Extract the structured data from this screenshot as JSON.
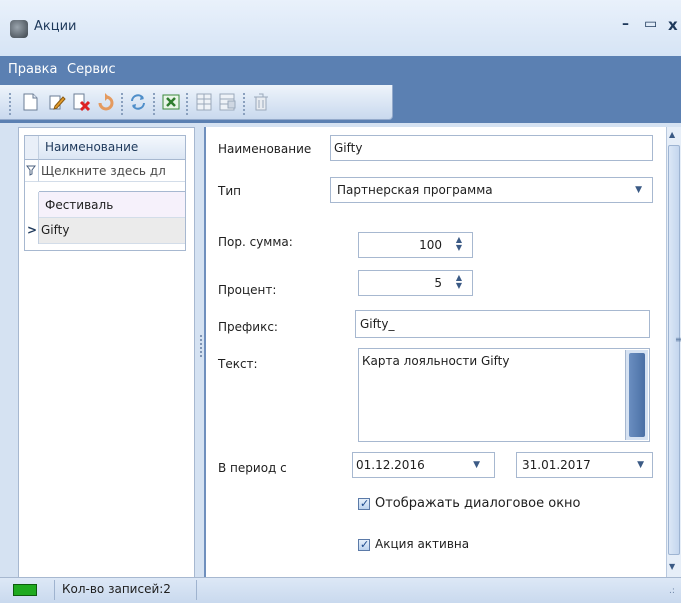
{
  "window": {
    "title": "Акции",
    "minimize_glyph": "–",
    "maximize_glyph": "▭",
    "close_glyph": "x"
  },
  "menu": {
    "items": [
      "Правка",
      "Сервис"
    ]
  },
  "toolbar": {
    "icons": [
      "new-document-icon",
      "edit-icon",
      "delete-icon",
      "undo-icon",
      "refresh-icon",
      "excel-export-icon",
      "columns-icon",
      "columns-settings-icon",
      "trash-icon"
    ]
  },
  "grid": {
    "header": "Наименование",
    "filter_placeholder": "Щелкните здесь дл",
    "rows": [
      {
        "name": "Фестиваль",
        "selected": false
      },
      {
        "name": "Gifty",
        "selected": true
      }
    ],
    "row_indicator": ">"
  },
  "form": {
    "name": {
      "label": "Наименование",
      "value": "Gifty"
    },
    "type": {
      "label": "Тип",
      "value": "Партнерская программа"
    },
    "threshold": {
      "label": "Пор. сумма:",
      "value": "100"
    },
    "percent": {
      "label": "Процент:",
      "value": "5"
    },
    "prefix": {
      "label": "Префикс:",
      "value": "Gifty_"
    },
    "text": {
      "label": "Текст:",
      "value": "Карта лояльности Gifty"
    },
    "period": {
      "label": "В период с",
      "from": "01.12.2016",
      "to": "31.01.2017"
    },
    "show_dialog": {
      "label": "Отображать диалоговое окно",
      "checked": true
    },
    "active": {
      "label": "Акция активна",
      "checked": true
    }
  },
  "status": {
    "records_label": "Кол-во записей:2",
    "indicator_color": "#1faa1f"
  }
}
